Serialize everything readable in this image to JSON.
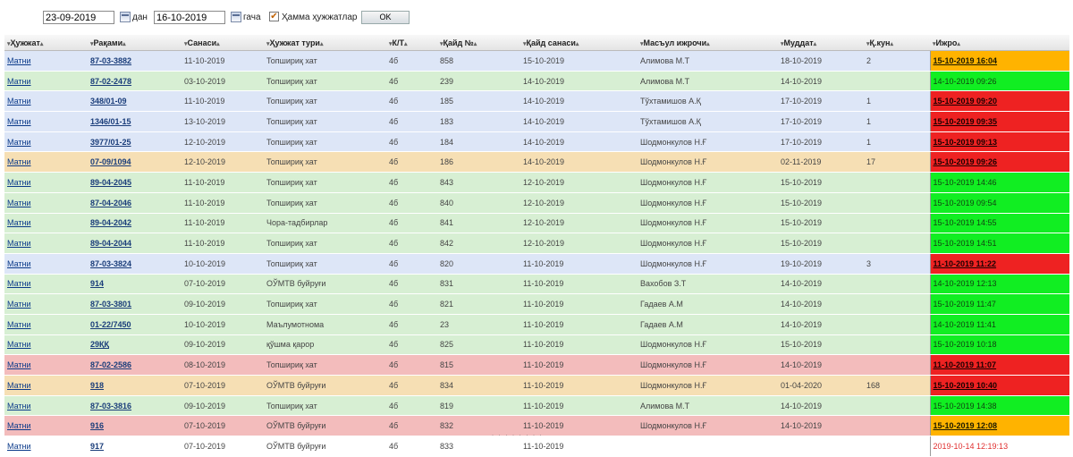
{
  "filter": {
    "date_from": "23-09-2019",
    "from_label": "дан",
    "date_to": "16-10-2019",
    "to_label": "гача",
    "all_docs_label": "Ҳамма ҳужжатлар",
    "all_docs_checked": true,
    "ok_label": "OK"
  },
  "columns": [
    "Ҳужжат",
    "Рақами",
    "Санаси",
    "Ҳужжат тури",
    "К/Т",
    "Қайд №",
    "Қайд санаси",
    "Масъул ижрочи",
    "Муддат",
    "Қ.кун",
    "Ижро"
  ],
  "rows": [
    {
      "doc": "Матни",
      "num": "87-03-3882",
      "date": "11-10-2019",
      "type": "Топшириқ хат",
      "kt": "4б",
      "reg": "858",
      "reg_date": "15-10-2019",
      "person": "Алимова М.Т",
      "due": "18-10-2019",
      "days": "2",
      "exec": "15-10-2019 16:04",
      "row_color": "blue",
      "exec_color": "orange"
    },
    {
      "doc": "Матни",
      "num": "87-02-2478",
      "date": "03-10-2019",
      "type": "Топшириқ хат",
      "kt": "4б",
      "reg": "239",
      "reg_date": "14-10-2019",
      "person": "Алимова М.Т",
      "due": "14-10-2019",
      "days": "",
      "exec": "14-10-2019 09:26",
      "row_color": "green",
      "exec_color": "green"
    },
    {
      "doc": "Матни",
      "num": "348/01-09",
      "date": "11-10-2019",
      "type": "Топшириқ хат",
      "kt": "4б",
      "reg": "185",
      "reg_date": "14-10-2019",
      "person": "Тўхтамишов А.Қ",
      "due": "17-10-2019",
      "days": "1",
      "exec": "15-10-2019 09:20",
      "row_color": "blue",
      "exec_color": "red"
    },
    {
      "doc": "Матни",
      "num": "1346/01-15",
      "date": "13-10-2019",
      "type": "Топшириқ хат",
      "kt": "4б",
      "reg": "183",
      "reg_date": "14-10-2019",
      "person": "Тўхтамишов А.Қ",
      "due": "17-10-2019",
      "days": "1",
      "exec": "15-10-2019 09:35",
      "row_color": "blue",
      "exec_color": "red"
    },
    {
      "doc": "Матни",
      "num": "3977/01-25",
      "date": "12-10-2019",
      "type": "Топшириқ хат",
      "kt": "4б",
      "reg": "184",
      "reg_date": "14-10-2019",
      "person": "Шодмонкулов Н.Ғ",
      "due": "17-10-2019",
      "days": "1",
      "exec": "15-10-2019 09:13",
      "row_color": "blue",
      "exec_color": "red"
    },
    {
      "doc": "Матни",
      "num": "07-09/1094",
      "date": "12-10-2019",
      "type": "Топшириқ хат",
      "kt": "4б",
      "reg": "186",
      "reg_date": "14-10-2019",
      "person": "Шодмонкулов Н.Ғ",
      "due": "02-11-2019",
      "days": "17",
      "exec": "15-10-2019 09:26",
      "row_color": "orange",
      "exec_color": "red"
    },
    {
      "doc": "Матни",
      "num": "89-04-2045",
      "date": "11-10-2019",
      "type": "Топшириқ хат",
      "kt": "4б",
      "reg": "843",
      "reg_date": "12-10-2019",
      "person": "Шодмонкулов Н.Ғ",
      "due": "15-10-2019",
      "days": "",
      "exec": "15-10-2019 14:46",
      "row_color": "green",
      "exec_color": "green"
    },
    {
      "doc": "Матни",
      "num": "87-04-2046",
      "date": "11-10-2019",
      "type": "Топшириқ хат",
      "kt": "4б",
      "reg": "840",
      "reg_date": "12-10-2019",
      "person": "Шодмонкулов Н.Ғ",
      "due": "15-10-2019",
      "days": "",
      "exec": "15-10-2019 09:54",
      "row_color": "green",
      "exec_color": "green"
    },
    {
      "doc": "Матни",
      "num": "89-04-2042",
      "date": "11-10-2019",
      "type": "Чора-тадбирлар",
      "kt": "4б",
      "reg": "841",
      "reg_date": "12-10-2019",
      "person": "Шодмонкулов Н.Ғ",
      "due": "15-10-2019",
      "days": "",
      "exec": "15-10-2019 14:55",
      "row_color": "green",
      "exec_color": "green"
    },
    {
      "doc": "Матни",
      "num": "89-04-2044",
      "date": "11-10-2019",
      "type": "Топшириқ хат",
      "kt": "4б",
      "reg": "842",
      "reg_date": "12-10-2019",
      "person": "Шодмонкулов Н.Ғ",
      "due": "15-10-2019",
      "days": "",
      "exec": "15-10-2019 14:51",
      "row_color": "green",
      "exec_color": "green"
    },
    {
      "doc": "Матни",
      "num": "87-03-3824",
      "date": "10-10-2019",
      "type": "Топшириқ хат",
      "kt": "4б",
      "reg": "820",
      "reg_date": "11-10-2019",
      "person": "Шодмонкулов Н.Ғ",
      "due": "19-10-2019",
      "days": "3",
      "exec": "11-10-2019 11:22",
      "row_color": "blue",
      "exec_color": "red"
    },
    {
      "doc": "Матни",
      "num": "914",
      "date": "07-10-2019",
      "type": "ОЎМТВ буйруғи",
      "kt": "4б",
      "reg": "831",
      "reg_date": "11-10-2019",
      "person": "Вахобов З.Т",
      "due": "14-10-2019",
      "days": "",
      "exec": "14-10-2019 12:13",
      "row_color": "green",
      "exec_color": "green"
    },
    {
      "doc": "Матни",
      "num": "87-03-3801",
      "date": "09-10-2019",
      "type": "Топшириқ хат",
      "kt": "4б",
      "reg": "821",
      "reg_date": "11-10-2019",
      "person": "Гадаев А.М",
      "due": "14-10-2019",
      "days": "",
      "exec": "15-10-2019 11:47",
      "row_color": "green",
      "exec_color": "green"
    },
    {
      "doc": "Матни",
      "num": "01-22/7450",
      "date": "10-10-2019",
      "type": "Маълумотнома",
      "kt": "4б",
      "reg": "23",
      "reg_date": "11-10-2019",
      "person": "Гадаев А.М",
      "due": "14-10-2019",
      "days": "",
      "exec": "14-10-2019 11:41",
      "row_color": "green",
      "exec_color": "green"
    },
    {
      "doc": "Матни",
      "num": "29ҚҚ",
      "date": "09-10-2019",
      "type": "қўшма қарор",
      "kt": "4б",
      "reg": "825",
      "reg_date": "11-10-2019",
      "person": "Шодмонкулов Н.Ғ",
      "due": "15-10-2019",
      "days": "",
      "exec": "15-10-2019 10:18",
      "row_color": "green",
      "exec_color": "green"
    },
    {
      "doc": "Матни",
      "num": "87-02-2586",
      "date": "08-10-2019",
      "type": "Топшириқ хат",
      "kt": "4б",
      "reg": "815",
      "reg_date": "11-10-2019",
      "person": "Шодмонкулов Н.Ғ",
      "due": "14-10-2019",
      "days": "",
      "exec": "11-10-2019 11:07",
      "row_color": "pink",
      "exec_color": "red"
    },
    {
      "doc": "Матни",
      "num": "918",
      "date": "07-10-2019",
      "type": "ОЎМТВ буйруғи",
      "kt": "4б",
      "reg": "834",
      "reg_date": "11-10-2019",
      "person": "Шодмонкулов Н.Ғ",
      "due": "01-04-2020",
      "days": "168",
      "exec": "15-10-2019 10:40",
      "row_color": "orange",
      "exec_color": "red"
    },
    {
      "doc": "Матни",
      "num": "87-03-3816",
      "date": "09-10-2019",
      "type": "Топшириқ хат",
      "kt": "4б",
      "reg": "819",
      "reg_date": "11-10-2019",
      "person": "Алимова М.Т",
      "due": "14-10-2019",
      "days": "",
      "exec": "15-10-2019 14:38",
      "row_color": "green",
      "exec_color": "green"
    },
    {
      "doc": "Матни",
      "num": "916",
      "date": "07-10-2019",
      "type": "ОЎМТВ буйруғи",
      "kt": "4б",
      "reg": "832",
      "reg_date": "11-10-2019",
      "person": "Шодмонкулов Н.Ғ",
      "due": "14-10-2019",
      "days": "",
      "exec": "15-10-2019 12:08",
      "row_color": "pink",
      "exec_color": "orange"
    },
    {
      "doc": "Матни",
      "num": "917",
      "date": "07-10-2019",
      "type": "ОЎМТВ буйруғи",
      "kt": "4б",
      "reg": "833",
      "reg_date": "11-10-2019",
      "person": "",
      "due": "",
      "days": "",
      "exec": "2019-10-14 12:19:13",
      "row_color": "white",
      "exec_color": "white"
    }
  ]
}
